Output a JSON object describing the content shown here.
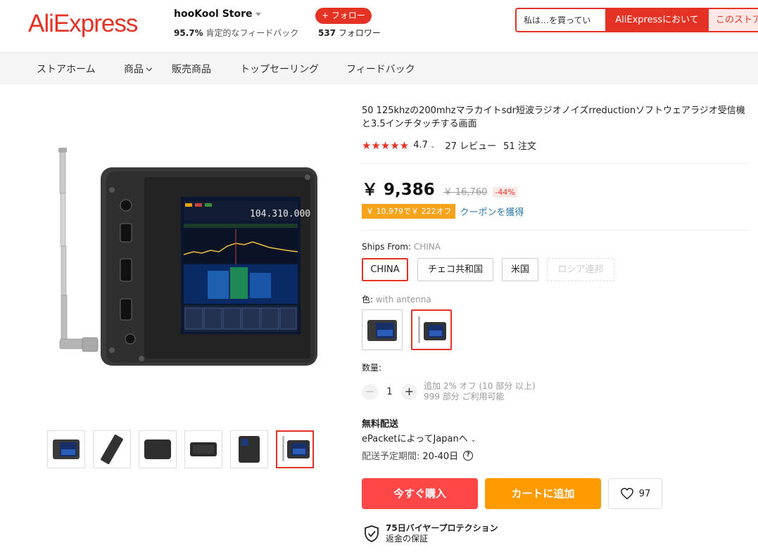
{
  "header": {
    "logo": "AliExpress",
    "store_name": "hooKool Store",
    "feedback_percent": "95.7%",
    "feedback_label": " 肯定的なフィードバック",
    "follow_button": "+ フォロー",
    "followers_count": "537",
    "followers_label": " フォロワー",
    "search_placeholder": "私は…を買ってい",
    "search_aliexpress": "AliExpressにおいて",
    "search_store": "このストア"
  },
  "nav": {
    "items": [
      "ストアホーム",
      "商品",
      "販売商品",
      "トップセーリング",
      "フィードバック"
    ]
  },
  "gallery": {
    "thumbnail_count": 6,
    "active_index": 5
  },
  "product": {
    "title": "50 125khzの200mhzマラカイトsdr短波ラジオノイズrreductionソフトウェアラジオ受信機と3.5インチタッチする画面",
    "rating": "4.7",
    "rating_stars": 4.7,
    "reviews": "27 レビュー",
    "orders": "51 注文",
    "price": "￥ 9,386",
    "original_price": "￥ 16,760",
    "discount": "-44%",
    "coupon": "￥ 10,979で￥ 222オフ",
    "coupon_link": "クーポンを獲得"
  },
  "ships_from": {
    "label": "Ships From: ",
    "selected": "CHINA",
    "options": [
      "CHINA",
      "チェコ共和国",
      "米国",
      "ロシア連邦"
    ]
  },
  "color": {
    "label": "色: ",
    "selected": "with antenna"
  },
  "quantity": {
    "label": "数量:",
    "value": "1",
    "minus": "−",
    "plus": "+",
    "info_line1": "追加 2% オフ (10 部分 以上)",
    "info_line2": "999 部分 ご利用可能"
  },
  "shipping": {
    "title": "無料配送",
    "method": "ePacketによってJapanへ",
    "time_label": "配送予定期間:",
    "time_value": "20-40日",
    "help": "?"
  },
  "actions": {
    "buy_now": "今すぐ購入",
    "add_to_cart": "カートに追加",
    "wishlist_count": "97"
  },
  "protection": {
    "title": "75日バイヤープロテクション",
    "subtitle": "返金の保証"
  },
  "colors": {
    "brand": "#e43225",
    "buy": "#ff4747",
    "cart": "#ff9a00",
    "coupon": "#f5a31a",
    "link": "#2e78a8"
  }
}
